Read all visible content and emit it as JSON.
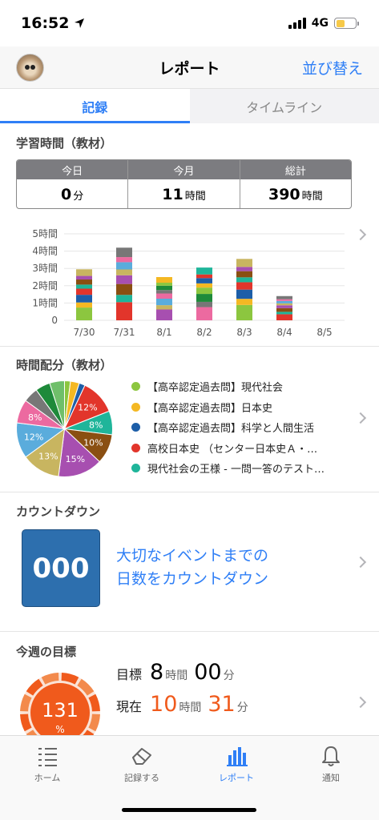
{
  "status_bar": {
    "time": "16:52",
    "network": "4G"
  },
  "nav": {
    "title": "レポート",
    "action": "並び替え"
  },
  "tabs": [
    {
      "label": "記録",
      "active": true
    },
    {
      "label": "タイムライン",
      "active": false
    }
  ],
  "study_time": {
    "title": "学習時間（教材）",
    "totals": [
      {
        "header": "今日",
        "value": "0",
        "unit": "分"
      },
      {
        "header": "今月",
        "value": "11",
        "unit": "時間"
      },
      {
        "header": "総計",
        "value": "390",
        "unit": "時間"
      }
    ]
  },
  "chart_data": [
    {
      "type": "bar",
      "stacked": true,
      "categories": [
        "7/30",
        "7/31",
        "8/1",
        "8/2",
        "8/3",
        "8/4",
        "8/5"
      ],
      "yticks": [
        "0",
        "1時間",
        "2時間",
        "3時間",
        "4時間",
        "5時間"
      ],
      "ylim": [
        0,
        5
      ],
      "totals_hours": [
        2.95,
        4.2,
        2.5,
        3.05,
        3.55,
        1.4,
        0
      ],
      "grid": true
    },
    {
      "type": "pie",
      "title": "時間配分（教材）",
      "slice_labels": [
        "12%",
        "8%",
        "10%",
        "15%",
        "13%",
        "12%",
        "8%"
      ],
      "slices": [
        {
          "value": 2,
          "color": "#8cc63f"
        },
        {
          "value": 3,
          "color": "#f4b823"
        },
        {
          "value": 2,
          "color": "#1d5ea8"
        },
        {
          "value": 12,
          "color": "#e2352b"
        },
        {
          "value": 8,
          "color": "#1fb59a"
        },
        {
          "value": 10,
          "color": "#8a4f12"
        },
        {
          "value": 15,
          "color": "#a74fb0"
        },
        {
          "value": 13,
          "color": "#c8b560"
        },
        {
          "value": 12,
          "color": "#5aacdc"
        },
        {
          "value": 8,
          "color": "#ec6aa0"
        },
        {
          "value": 5,
          "color": "#777777"
        },
        {
          "value": 5,
          "color": "#1e8a3a"
        },
        {
          "value": 5,
          "color": "#6fbf6a"
        }
      ],
      "legend": [
        {
          "label": "【高卒認定過去問】現代社会",
          "color": "#8cc63f"
        },
        {
          "label": "【高卒認定過去問】日本史",
          "color": "#f4b823"
        },
        {
          "label": "【高卒認定過去問】科学と人間生活",
          "color": "#1d5ea8"
        },
        {
          "label": "高校日本史 （センター日本史Ａ・…",
          "color": "#e2352b"
        },
        {
          "label": "現代社会の王様 - 一問一答のテスト…",
          "color": "#1fb59a"
        }
      ]
    }
  ],
  "countdown": {
    "title": "カウントダウン",
    "number": "000",
    "text_line1": "大切なイベントまでの",
    "text_line2": "日数をカウントダウン"
  },
  "weekly_goal": {
    "title": "今週の目標",
    "percent": "131",
    "percent_sign": "%",
    "progress_fraction": 1.31,
    "goal_label": "目標",
    "goal_hours": "8",
    "goal_minutes": "00",
    "current_label": "現在",
    "current_hours": "10",
    "current_minutes": "31",
    "hour_unit": "時間",
    "minute_unit": "分"
  },
  "tab_bar": [
    {
      "label": "ホーム",
      "icon": "list-icon",
      "active": false
    },
    {
      "label": "記録する",
      "icon": "eraser-icon",
      "active": false
    },
    {
      "label": "レポート",
      "icon": "bar-chart-icon",
      "active": true
    },
    {
      "label": "通知",
      "icon": "bell-icon",
      "active": false
    }
  ],
  "colors": {
    "accent": "#2f7ff6",
    "goal_orange": "#f05a1c",
    "countdown_blue": "#2d6fae"
  }
}
